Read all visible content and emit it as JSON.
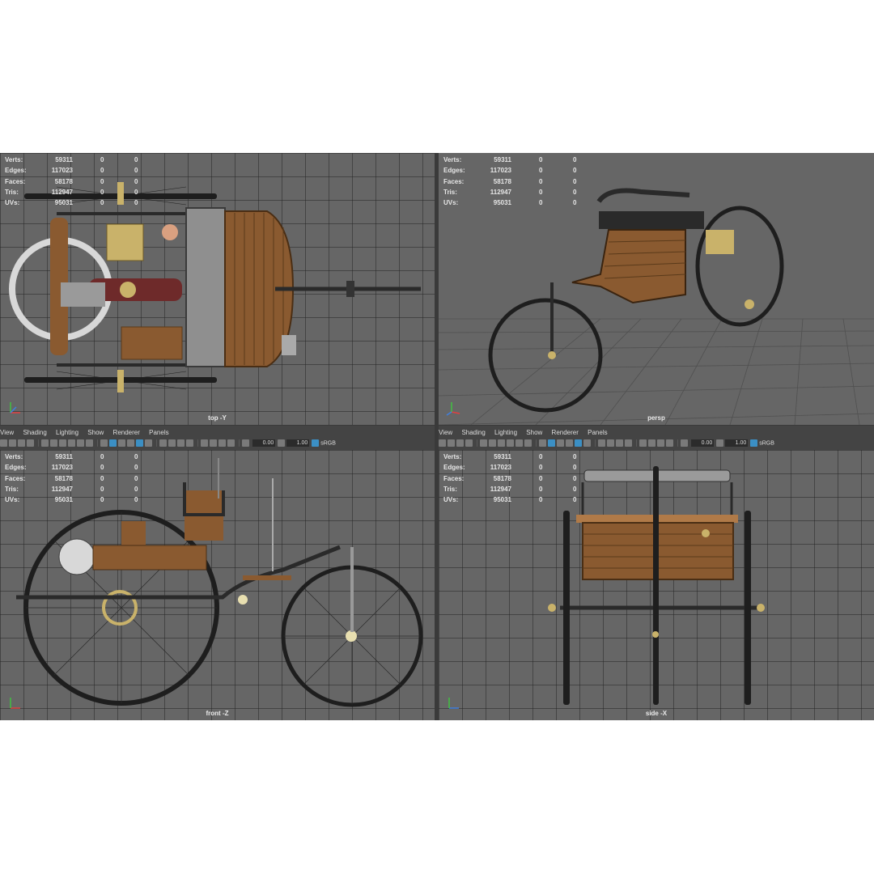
{
  "stats": {
    "labels": [
      "Verts:",
      "Edges:",
      "Faces:",
      "Tris:",
      "UVs:"
    ],
    "values": [
      "59311",
      "117023",
      "58178",
      "112947",
      "95031"
    ],
    "sel_a": "0",
    "sel_b": "0"
  },
  "viewports": {
    "top": "top -Y",
    "persp": "persp",
    "front": "front -Z",
    "side": "side -X"
  },
  "panel_menu": [
    "View",
    "Shading",
    "Lighting",
    "Show",
    "Renderer",
    "Panels"
  ],
  "toolbar": {
    "exposure": "0.00",
    "gamma": "1.00",
    "colorspace": "sRGB"
  },
  "colors": {
    "viewport_bg": "#666666",
    "grid_line": "#3c3c3c",
    "wood": "#8a5a30",
    "iron": "#2a2a2a",
    "brass": "#c9b26a",
    "engine_red": "#6e2a2a",
    "axis_x": "#e04040",
    "axis_y": "#40c040",
    "axis_z": "#4080e0"
  },
  "icons": [
    "axis-gizmo-icon",
    "camera-icon",
    "grid-icon",
    "wireframe-icon",
    "shaded-icon",
    "texture-icon",
    "light-icon",
    "shadow-icon",
    "isolate-icon",
    "xray-icon"
  ]
}
